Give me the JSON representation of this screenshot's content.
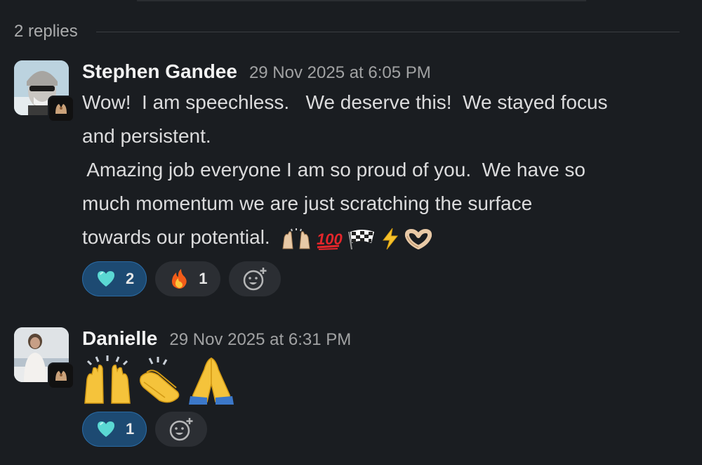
{
  "thread": {
    "replies_label": "2 replies"
  },
  "messages": [
    {
      "author": "Stephen Gandee",
      "timestamp": "29 Nov 2025 at 6:05 PM",
      "lines": [
        "Wow!  I am speechless.   We deserve this!  We stayed focus",
        "and persistent.",
        " Amazing job everyone I am so proud of you.  We have so",
        "much momentum we are just scratching the surface",
        "towards our potential."
      ],
      "inline_emojis": [
        "raised-hands-emoji",
        "hundred-points-emoji",
        "checkered-flag-emoji",
        "lightning-emoji",
        "heart-hands-emoji"
      ],
      "reactions": [
        {
          "emoji": "light-blue-heart-emoji",
          "count": "2",
          "selected": true
        },
        {
          "emoji": "fire-emoji",
          "count": "1",
          "selected": false
        }
      ]
    },
    {
      "author": "Danielle",
      "timestamp": "29 Nov 2025 at 6:31 PM",
      "big_emojis": [
        "raised-hands-emoji",
        "clapping-hands-emoji",
        "folded-hands-emoji"
      ],
      "reactions": [
        {
          "emoji": "light-blue-heart-emoji",
          "count": "1",
          "selected": true
        }
      ]
    }
  ],
  "colors": {
    "background": "#1a1d21",
    "selected_reaction": "#1d4a72",
    "reaction": "#2b2e33"
  }
}
